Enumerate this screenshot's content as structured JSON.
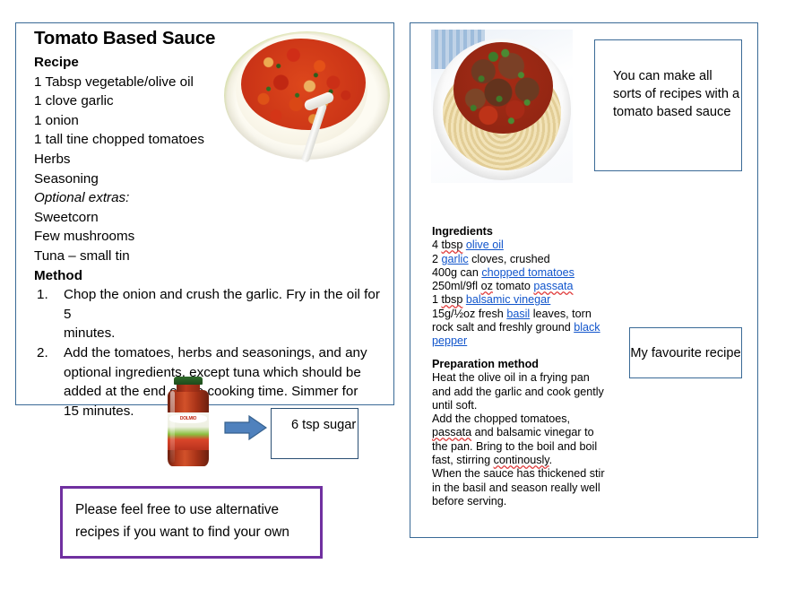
{
  "left_panel": {
    "title": "Tomato Based Sauce",
    "recipe_heading": "Recipe",
    "ingredients": [
      "1 Tabsp vegetable/olive oil",
      "1 clove garlic",
      "1 onion",
      "1 tall tine chopped tomatoes",
      "Herbs",
      "Seasoning"
    ],
    "optional_heading": "Optional extras:",
    "optional_items": [
      "Sweetcorn",
      "Few mushrooms",
      "Tuna – small tin"
    ],
    "method_heading": "Method",
    "method": [
      {
        "number": "1.",
        "lines": [
          "Chop the onion and crush the garlic. Fry in the oil for",
          "5",
          "minutes."
        ]
      },
      {
        "number": "2.",
        "lines": [
          "Add the tomatoes, herbs and seasonings, and any",
          "optional ingredients, except tuna which should be",
          "added at the end of the cooking time. Simmer for",
          "15 minutes."
        ]
      }
    ],
    "pasta_photo_alt": "penne pasta in tomato sauce in a green rimmed bowl"
  },
  "right_panel": {
    "spaghetti_photo_alt": "spaghetti with meatballs in tomato sauce",
    "ingredients_heading": "Ingredients",
    "ingredients_lines": [
      [
        {
          "t": "4 ",
          "s": "plain"
        },
        {
          "t": "tbsp",
          "s": "spell"
        },
        {
          "t": " ",
          "s": "plain"
        },
        {
          "t": "olive oil",
          "s": "link"
        }
      ],
      [
        {
          "t": "2 ",
          "s": "plain"
        },
        {
          "t": "garlic",
          "s": "link"
        },
        {
          "t": " cloves, crushed",
          "s": "plain"
        }
      ],
      [
        {
          "t": "400g can ",
          "s": "plain"
        },
        {
          "t": "chopped tomatoes",
          "s": "link"
        }
      ],
      [
        {
          "t": "250ml/9fl ",
          "s": "plain"
        },
        {
          "t": "oz",
          "s": "spell"
        },
        {
          "t": " tomato ",
          "s": "plain"
        },
        {
          "t": "passata",
          "s": "linkspell"
        }
      ],
      [
        {
          "t": "1 ",
          "s": "plain"
        },
        {
          "t": "tbsp",
          "s": "spell"
        },
        {
          "t": " ",
          "s": "plain"
        },
        {
          "t": "balsamic vinegar",
          "s": "link"
        }
      ],
      [
        {
          "t": "15g/½oz fresh ",
          "s": "plain"
        },
        {
          "t": "basil",
          "s": "link"
        },
        {
          "t": " leaves, torn",
          "s": "plain"
        }
      ],
      [
        {
          "t": "rock salt and freshly ground ",
          "s": "plain"
        },
        {
          "t": "black",
          "s": "link"
        }
      ],
      [
        {
          "t": "pepper",
          "s": "link"
        }
      ]
    ],
    "preparation_heading": "Preparation method",
    "preparation_lines": [
      [
        {
          "t": "Heat the olive oil in a frying pan",
          "s": "plain"
        }
      ],
      [
        {
          "t": "and add the garlic and cook gently",
          "s": "plain"
        }
      ],
      [
        {
          "t": "until soft.",
          "s": "plain"
        }
      ],
      [
        {
          "t": "Add the chopped tomatoes,",
          "s": "plain"
        }
      ],
      [
        {
          "t": "passata",
          "s": "spell"
        },
        {
          "t": " and balsamic vinegar to",
          "s": "plain"
        }
      ],
      [
        {
          "t": "the pan. Bring to the boil and boil",
          "s": "plain"
        }
      ],
      [
        {
          "t": "fast, stirring ",
          "s": "plain"
        },
        {
          "t": "continously",
          "s": "spell"
        },
        {
          "t": ".",
          "s": "plain"
        }
      ],
      [
        {
          "t": "When the sauce has thickened stir",
          "s": "plain"
        }
      ],
      [
        {
          "t": "in the basil and season really well",
          "s": "plain"
        }
      ],
      [
        {
          "t": "before serving.",
          "s": "plain"
        }
      ]
    ]
  },
  "callouts": {
    "sorts_of_recipes": "You can make all sorts of recipes with a tomato based sauce",
    "favourite": "My favourite recipe",
    "sugar": "6 tsp sugar",
    "alternative": "Please feel free to use alternative recipes if you want to find your own"
  },
  "jar": {
    "brand": "DOLMIO",
    "alt": "Dolmio classic tomato pasta sauce jar"
  },
  "colors": {
    "panel_border": "#3a6a96",
    "purple_border": "#7030a0",
    "arrow_fill": "#4f81bd",
    "arrow_stroke": "#36618e",
    "link": "#1155cc",
    "spell_underline": "#e03b3b"
  }
}
